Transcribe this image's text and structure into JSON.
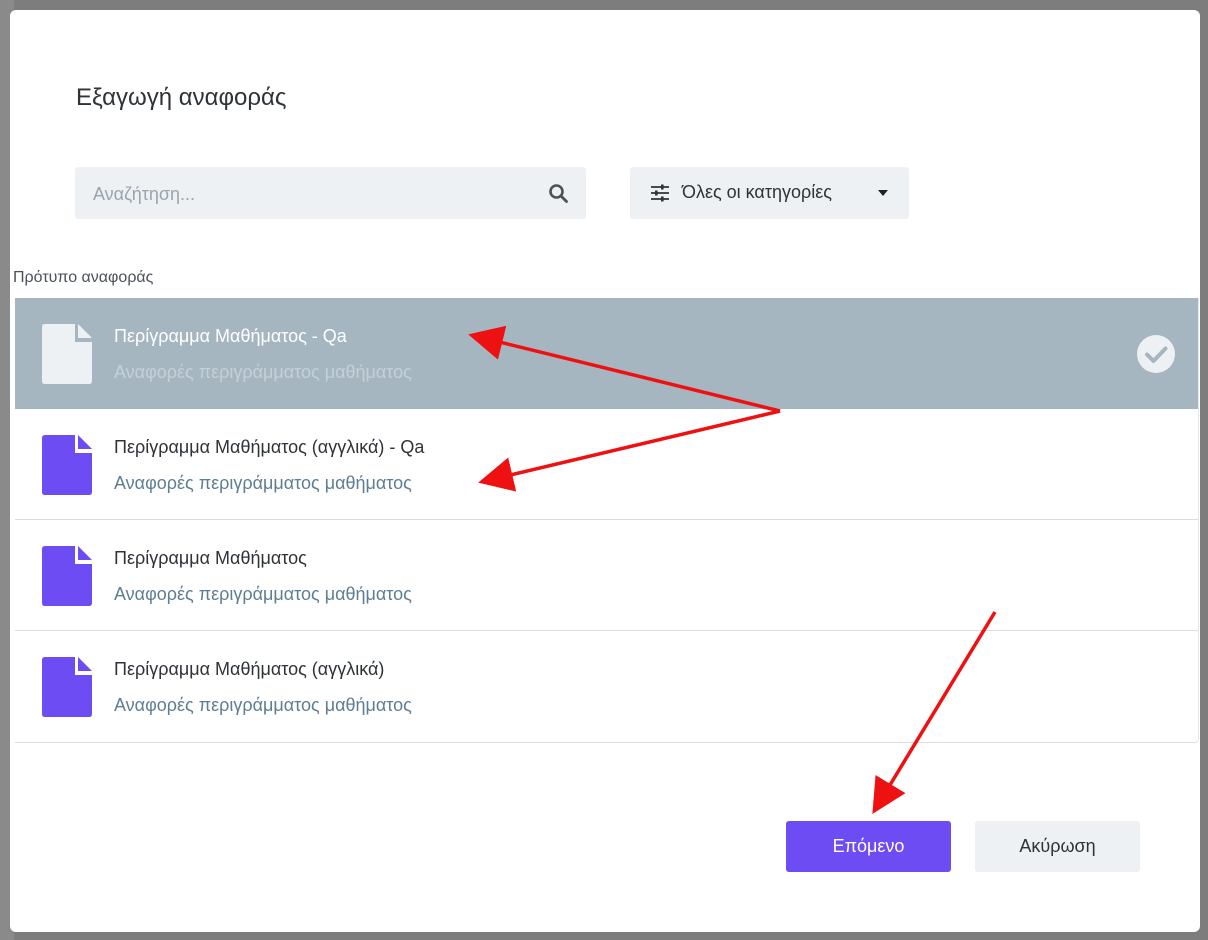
{
  "modal": {
    "title": "Εξαγωγή αναφοράς"
  },
  "search": {
    "placeholder": "Αναζήτηση..."
  },
  "filter": {
    "label": "Όλες οι κατηγορίες"
  },
  "list": {
    "section_label": "Πρότυπο αναφοράς",
    "items": [
      {
        "title": "Περίγραμμα Μαθήματος - Qa",
        "subtitle": "Αναφορές περιγράμματος μαθήματος",
        "selected": true
      },
      {
        "title": "Περίγραμμα Μαθήματος (αγγλικά) - Qa",
        "subtitle": "Αναφορές περιγράμματος μαθήματος",
        "selected": false
      },
      {
        "title": "Περίγραμμα Μαθήματος",
        "subtitle": "Αναφορές περιγράμματος μαθήματος",
        "selected": false
      },
      {
        "title": "Περίγραμμα Μαθήματος (αγγλικά)",
        "subtitle": "Αναφορές περιγράμματος μαθήματος",
        "selected": false
      }
    ]
  },
  "actions": {
    "next_label": "Επόμενο",
    "cancel_label": "Ακύρωση"
  },
  "colors": {
    "accent": "#6d4cf3",
    "selected_row": "#a6b6c0",
    "annotation_arrow": "#ee1111"
  }
}
